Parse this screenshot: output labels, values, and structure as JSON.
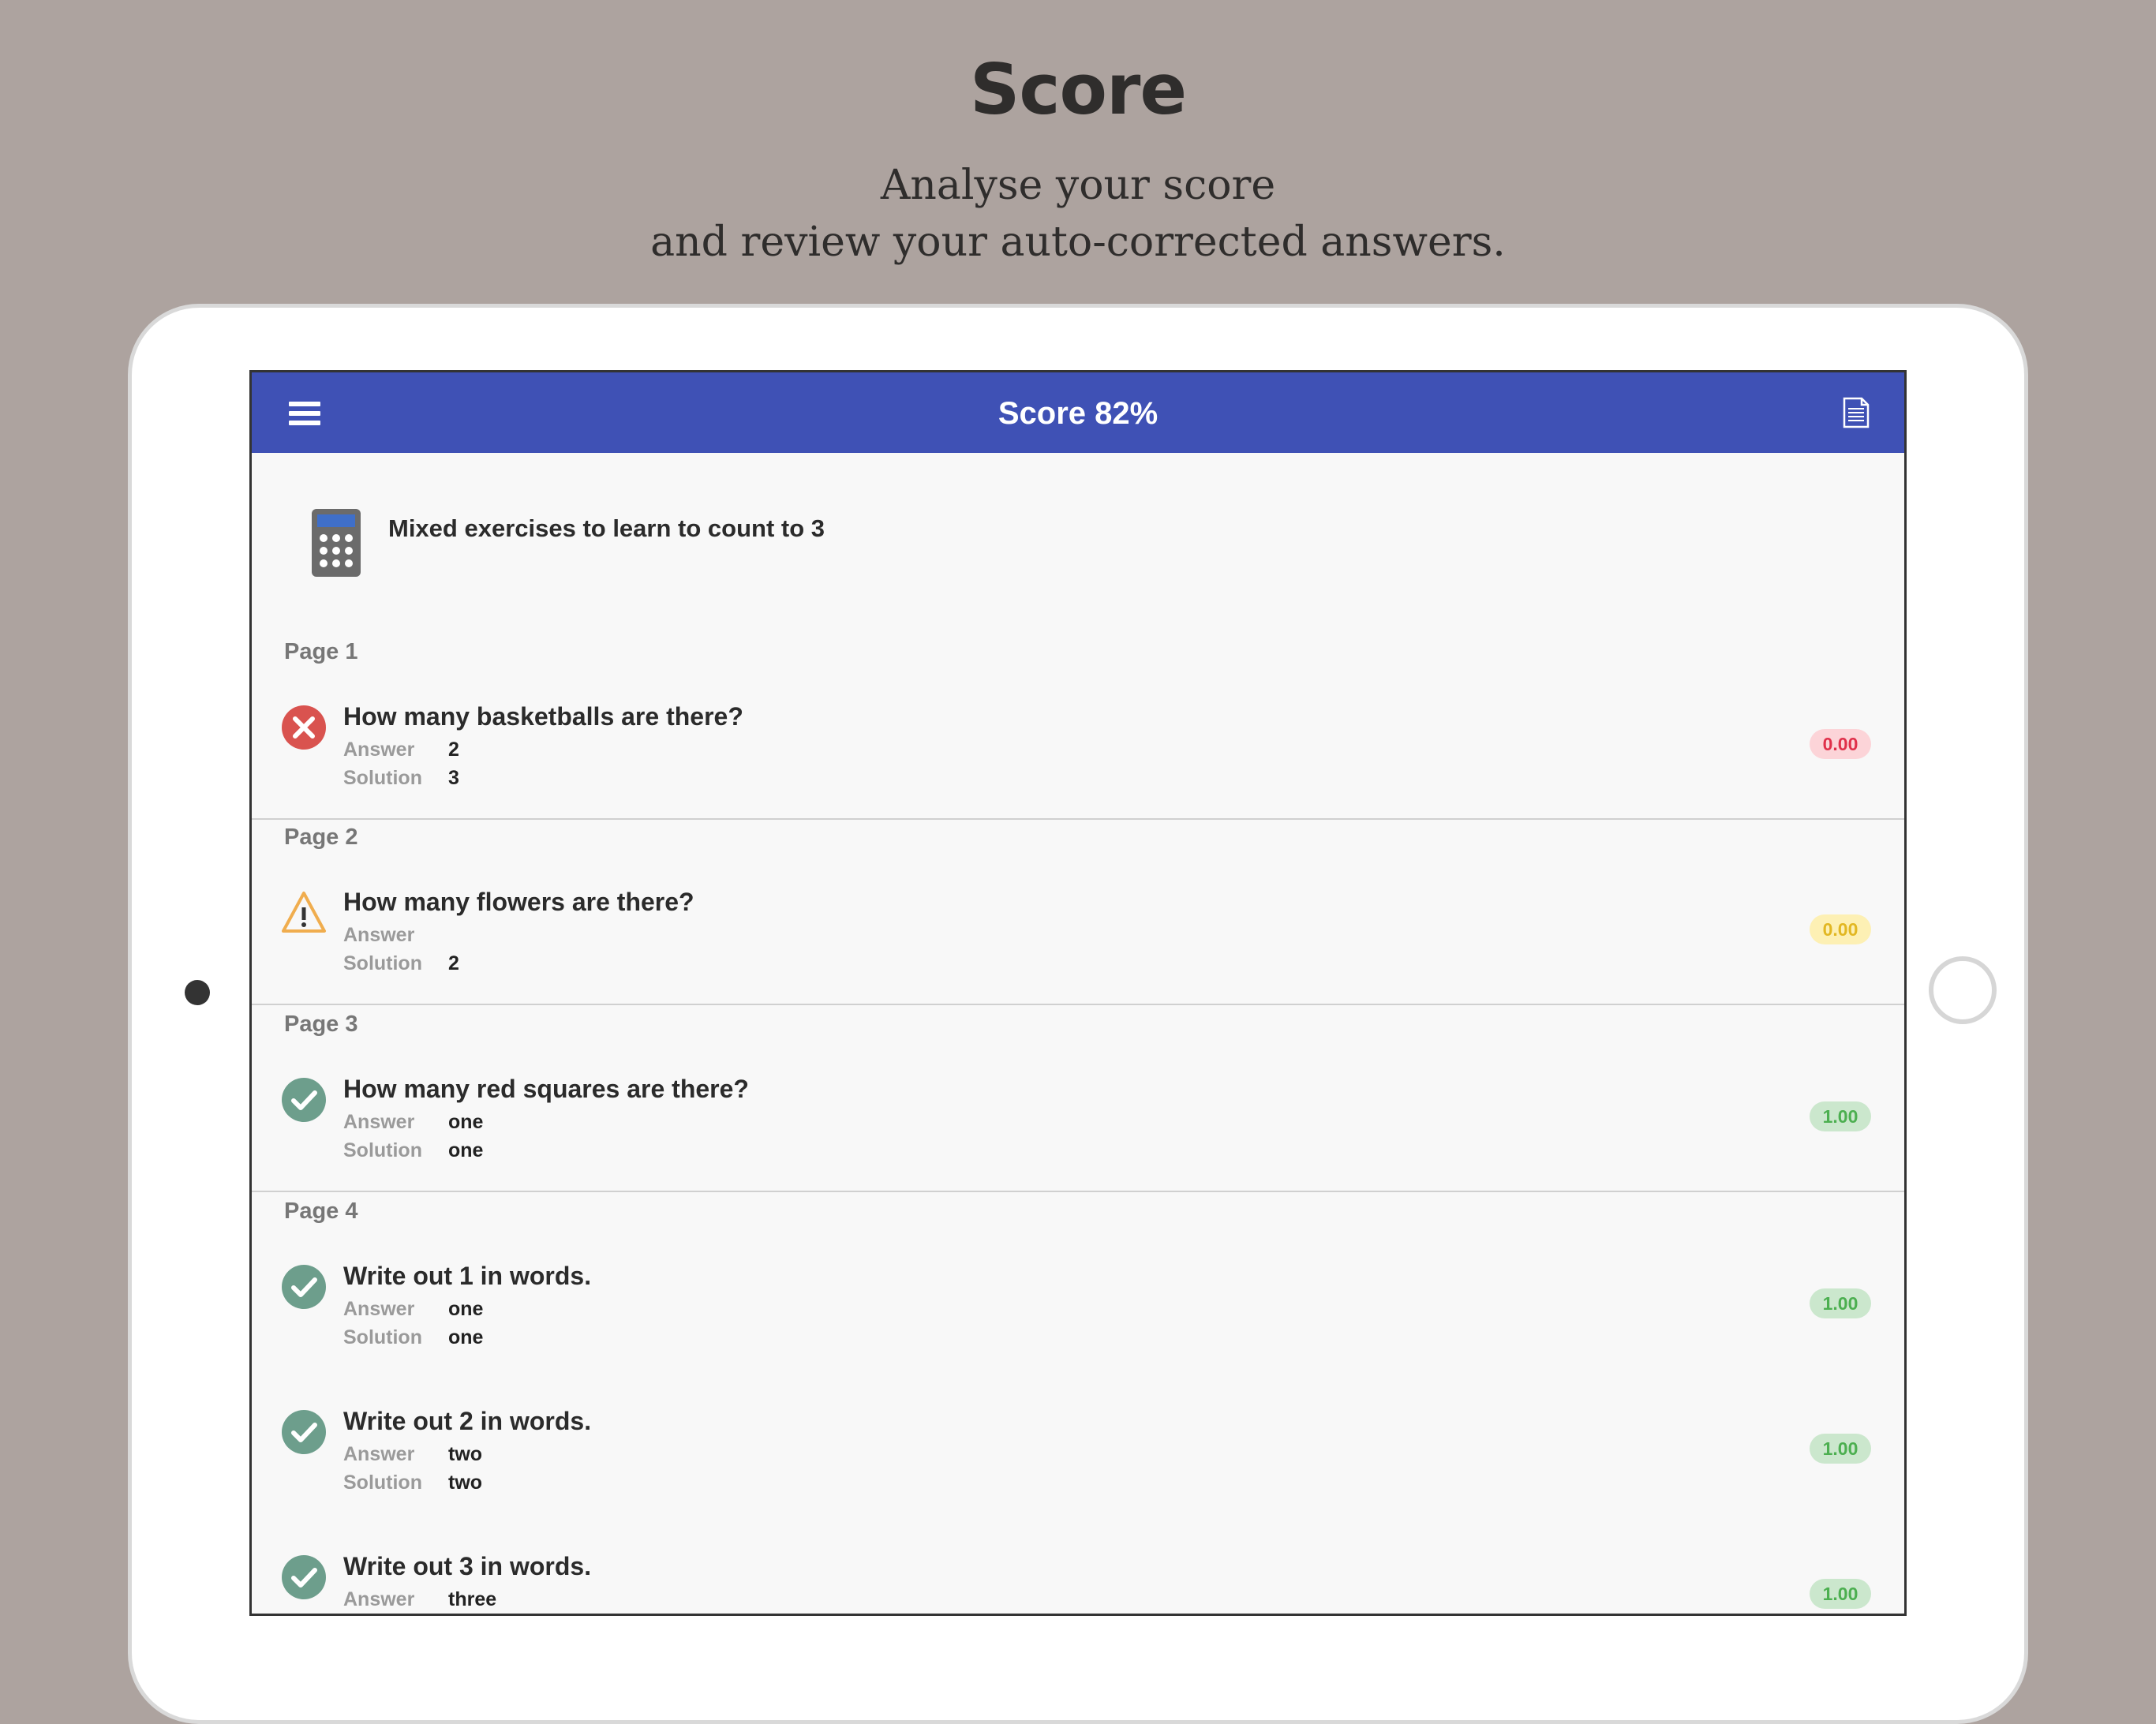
{
  "promo": {
    "title": "Score",
    "subtitle_line1": "Analyse your score",
    "subtitle_line2": "and review your auto-corrected answers."
  },
  "appbar": {
    "title": "Score 82%",
    "menu_icon": "hamburger-menu-icon",
    "action_icon": "document-icon",
    "color": "#3f51b5"
  },
  "exercise": {
    "icon": "calculator-icon",
    "title": "Mixed exercises to learn to count to 3"
  },
  "labels": {
    "answer": "Answer",
    "solution": "Solution"
  },
  "pages": [
    {
      "label": "Page 1",
      "questions": [
        {
          "status": "wrong",
          "text": "How many basketballs are there?",
          "answer": "2",
          "solution": "3",
          "score": "0.00"
        }
      ]
    },
    {
      "label": "Page 2",
      "questions": [
        {
          "status": "warning",
          "text": "How many flowers are there?",
          "answer": "",
          "solution": "2",
          "score": "0.00"
        }
      ]
    },
    {
      "label": "Page 3",
      "questions": [
        {
          "status": "correct",
          "text": "How many red squares are there?",
          "answer": "one",
          "solution": "one",
          "score": "1.00"
        }
      ]
    },
    {
      "label": "Page 4",
      "questions": [
        {
          "status": "correct",
          "text": "Write out 1 in words.",
          "answer": "one",
          "solution": "one",
          "score": "1.00"
        },
        {
          "status": "correct",
          "text": "Write out 2 in words.",
          "answer": "two",
          "solution": "two",
          "score": "1.00"
        },
        {
          "status": "correct",
          "text": "Write out 3 in words.",
          "answer": "three",
          "solution": "",
          "score": "1.00"
        }
      ]
    }
  ],
  "colors": {
    "wrong": "#d9534f",
    "warning": "#f0ad4e",
    "correct": "#6d9e8c"
  }
}
